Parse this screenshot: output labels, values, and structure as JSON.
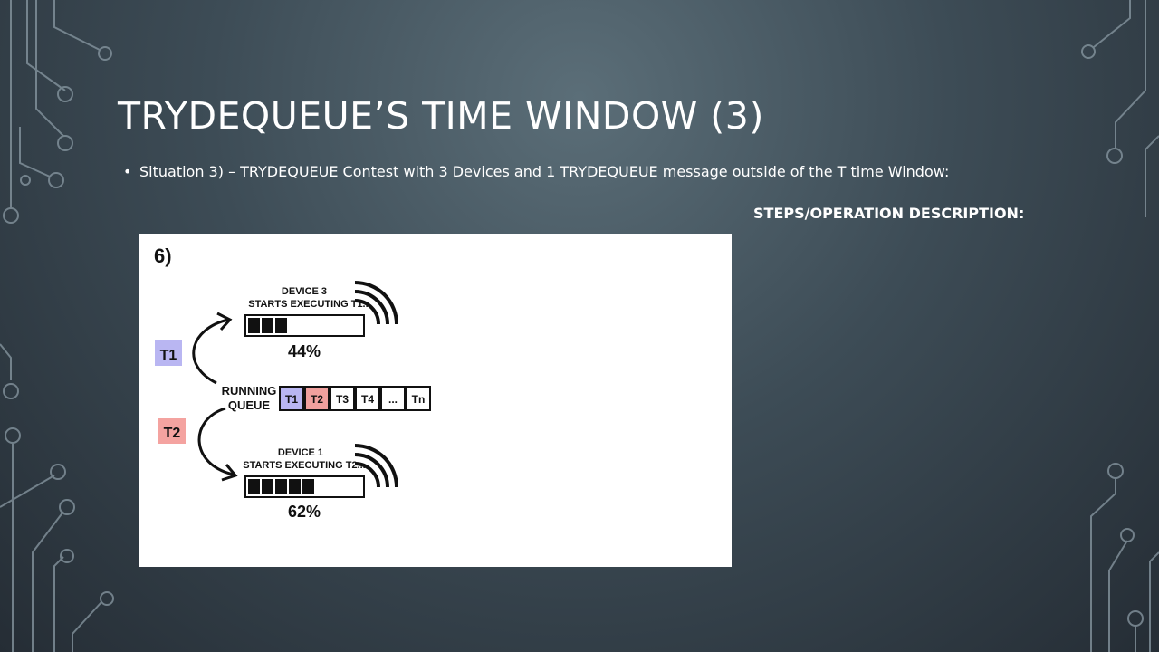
{
  "slide": {
    "title": "TRYDEQUEUE’S TIME WINDOW (3)",
    "bullet_text": "Situation 3) – TRYDEQUEUE Contest with 3 Devices and 1 TRYDEQUEUE message outside of the T time Window:",
    "steps_heading": "STEPS/OPERATION DESCRIPTION:"
  },
  "diagram": {
    "step_label": "6)",
    "device_top": {
      "line1": "DEVICE 3",
      "line2": "STARTS EXECUTING T1...",
      "percent_label": "44%",
      "progress": 0.44
    },
    "device_bottom": {
      "line1": "DEVICE 1",
      "line2": "STARTS EXECUTING T2...",
      "percent_label": "62%",
      "progress": 0.62
    },
    "task_left_top": "T1",
    "task_left_bottom": "T2",
    "queue_label_line1": "RUNNING",
    "queue_label_line2": "QUEUE",
    "queue_cells": [
      {
        "label": "T1",
        "color": "#b9b6f2"
      },
      {
        "label": "T2",
        "color": "#f0a09e"
      },
      {
        "label": "T3",
        "color": "#ffffff"
      },
      {
        "label": "T4",
        "color": "#ffffff"
      },
      {
        "label": "...",
        "color": "#ffffff"
      },
      {
        "label": "Tn",
        "color": "#ffffff"
      }
    ],
    "colors": {
      "t1": "#b9b6f2",
      "t2": "#f4a3a0",
      "ink": "#111111"
    }
  }
}
